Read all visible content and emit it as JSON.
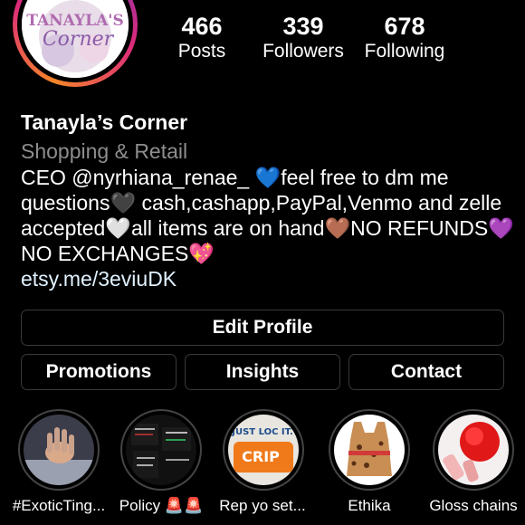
{
  "profile": {
    "logo_text": "TANAYLA'S Corner",
    "stats": [
      {
        "value": "466",
        "label": "Posts"
      },
      {
        "value": "339",
        "label": "Followers"
      },
      {
        "value": "678",
        "label": "Following"
      }
    ],
    "name": "Tanayla’s Corner",
    "category": "Shopping & Retail",
    "bio": "CEO @nyrhiana_renae_ 💙feel free to dm me questions🖤 cash,cashapp,PayPal,Venmo and zelle accepted🤍all items are on hand🤎NO REFUNDS💜NO EXCHANGES💖",
    "link": "etsy.me/3eviuDK"
  },
  "buttons": {
    "edit_profile": "Edit Profile",
    "promotions": "Promotions",
    "insights": "Insights",
    "contact": "Contact"
  },
  "highlights": [
    {
      "label": "#ExoticTing...",
      "icon": "hand-photo"
    },
    {
      "label": "Policy 🚨🚨",
      "icon": "policy-text-photo"
    },
    {
      "label": "Rep yo set...",
      "icon": "just-loc-it-sticker"
    },
    {
      "label": "Ethika",
      "icon": "leopard-top-photo"
    },
    {
      "label": "Gloss chains",
      "icon": "red-pompom-photo"
    }
  ],
  "colors": {
    "background": "#000000",
    "category_text": "#8e8e8e",
    "link_text": "#e0f1ff",
    "button_border": "#3a3a3a",
    "avatar_ring": "#dd2a7b"
  }
}
